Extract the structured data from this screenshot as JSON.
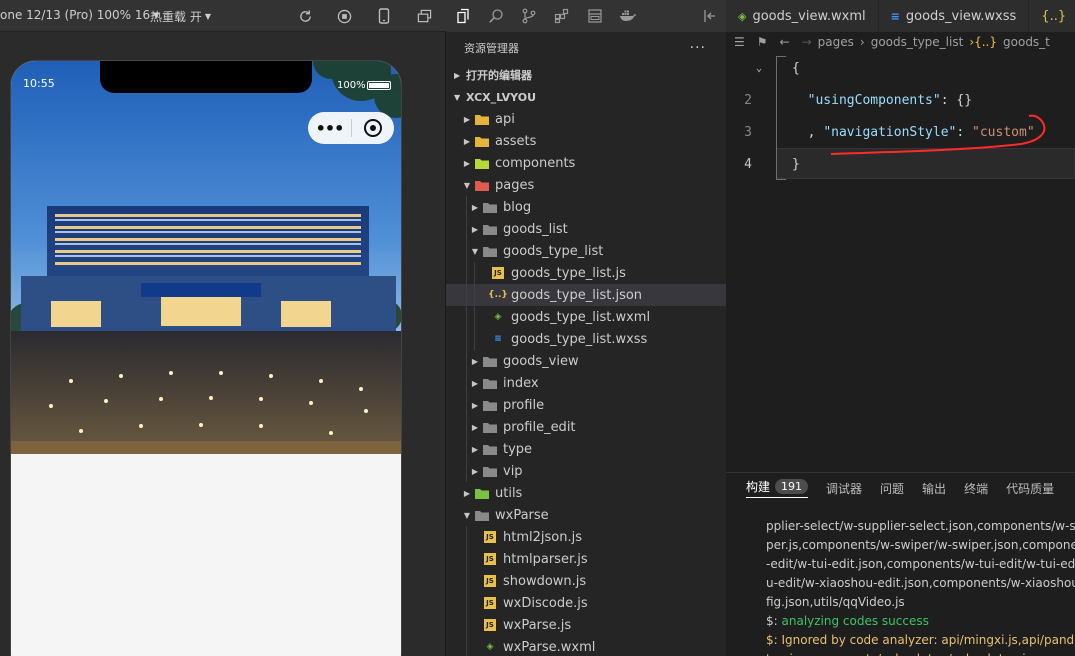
{
  "simulator": {
    "device_label": "one 12/13 (Pro) 100% 16",
    "hotreload_label": "热重载 开",
    "status_time": "10:55",
    "battery_text": "100%",
    "battery_level_pct": 100
  },
  "activity_bar": {
    "icons": [
      "files-icon",
      "search-icon",
      "source-control-icon",
      "extensions-icon",
      "layout-icon",
      "docker-icon"
    ]
  },
  "explorer": {
    "title": "资源管理器",
    "more": "···",
    "open_editors": "打开的编辑器",
    "project": "XCX_LVYOU",
    "tree": [
      {
        "label": "api",
        "depth": 1,
        "kind": "folder-yellow",
        "open": false
      },
      {
        "label": "assets",
        "depth": 1,
        "kind": "folder-yellow",
        "open": false
      },
      {
        "label": "components",
        "depth": 1,
        "kind": "folder-lime",
        "open": false
      },
      {
        "label": "pages",
        "depth": 1,
        "kind": "folder-red",
        "open": true
      },
      {
        "label": "blog",
        "depth": 2,
        "kind": "folder",
        "open": false
      },
      {
        "label": "goods_list",
        "depth": 2,
        "kind": "folder",
        "open": false
      },
      {
        "label": "goods_type_list",
        "depth": 2,
        "kind": "folder",
        "open": true
      },
      {
        "label": "goods_type_list.js",
        "depth": 3,
        "kind": "js"
      },
      {
        "label": "goods_type_list.json",
        "depth": 3,
        "kind": "json",
        "selected": true
      },
      {
        "label": "goods_type_list.wxml",
        "depth": 3,
        "kind": "wxml"
      },
      {
        "label": "goods_type_list.wxss",
        "depth": 3,
        "kind": "wxss"
      },
      {
        "label": "goods_view",
        "depth": 2,
        "kind": "folder",
        "open": false
      },
      {
        "label": "index",
        "depth": 2,
        "kind": "folder",
        "open": false
      },
      {
        "label": "profile",
        "depth": 2,
        "kind": "folder",
        "open": false
      },
      {
        "label": "profile_edit",
        "depth": 2,
        "kind": "folder",
        "open": false
      },
      {
        "label": "type",
        "depth": 2,
        "kind": "folder",
        "open": false
      },
      {
        "label": "vip",
        "depth": 2,
        "kind": "folder",
        "open": false
      },
      {
        "label": "utils",
        "depth": 1,
        "kind": "folder-green",
        "open": false
      },
      {
        "label": "wxParse",
        "depth": 1,
        "kind": "folder",
        "open": true
      },
      {
        "label": "html2json.js",
        "depth": 2,
        "kind": "js"
      },
      {
        "label": "htmlparser.js",
        "depth": 2,
        "kind": "js"
      },
      {
        "label": "showdown.js",
        "depth": 2,
        "kind": "js"
      },
      {
        "label": "wxDiscode.js",
        "depth": 2,
        "kind": "js"
      },
      {
        "label": "wxParse.js",
        "depth": 2,
        "kind": "js"
      },
      {
        "label": "wxParse.wxml",
        "depth": 2,
        "kind": "wxml"
      }
    ]
  },
  "editor": {
    "tabs": [
      {
        "label": "goods_view.wxml",
        "kind": "wxml"
      },
      {
        "label": "goods_view.wxss",
        "kind": "wxss"
      },
      {
        "label": "{..}",
        "kind": "json"
      }
    ],
    "breadcrumb": {
      "p1": "pages",
      "p2": "goods_type_list",
      "p3": "goods_t"
    },
    "lines": [
      {
        "n": "",
        "tokens": [
          {
            "t": "{",
            "c": "p"
          }
        ]
      },
      {
        "n": "2",
        "tokens": [
          {
            "t": "  \"usingComponents\"",
            "c": "k"
          },
          {
            "t": ": {}",
            "c": "p"
          }
        ]
      },
      {
        "n": "3",
        "tokens": [
          {
            "t": "  , ",
            "c": "p"
          },
          {
            "t": "\"navigationStyle\"",
            "c": "k"
          },
          {
            "t": ": ",
            "c": "p"
          },
          {
            "t": "\"custom\"",
            "c": "s"
          }
        ]
      },
      {
        "n": "4",
        "tokens": [
          {
            "t": "}",
            "c": "p"
          }
        ]
      }
    ]
  },
  "panel": {
    "tabs": [
      {
        "label": "构建",
        "badge": "191",
        "active": true
      },
      {
        "label": "调试器"
      },
      {
        "label": "问题"
      },
      {
        "label": "输出"
      },
      {
        "label": "终端"
      },
      {
        "label": "代码质量"
      }
    ],
    "output": [
      {
        "text": "pplier-select/w-supplier-select.json,components/w-supplier-sel",
        "cls": ""
      },
      {
        "text": "per.js,components/w-swiper/w-swiper.json,components/w-swiper/w",
        "cls": ""
      },
      {
        "text": "-edit/w-tui-edit.json,components/w-tui-edit/w-tui-edit.wxml",
        "cls": ""
      },
      {
        "text": "u-edit/w-xiaoshou-edit.json,components/w-xiaoshou-edit/w-xiao",
        "cls": ""
      },
      {
        "text": "fig.json,utils/qqVideo.js",
        "cls": ""
      },
      {
        "text": "$: analyzing codes success",
        "cls": "ok"
      },
      {
        "text": "$: Ignored by code analyzer: api/mingxi.js,api/pandian.js",
        "cls": "warn"
      },
      {
        "text": "top.js,components/w-back-top/w-back-top.json,components/w-back",
        "cls": "warn"
      }
    ]
  }
}
